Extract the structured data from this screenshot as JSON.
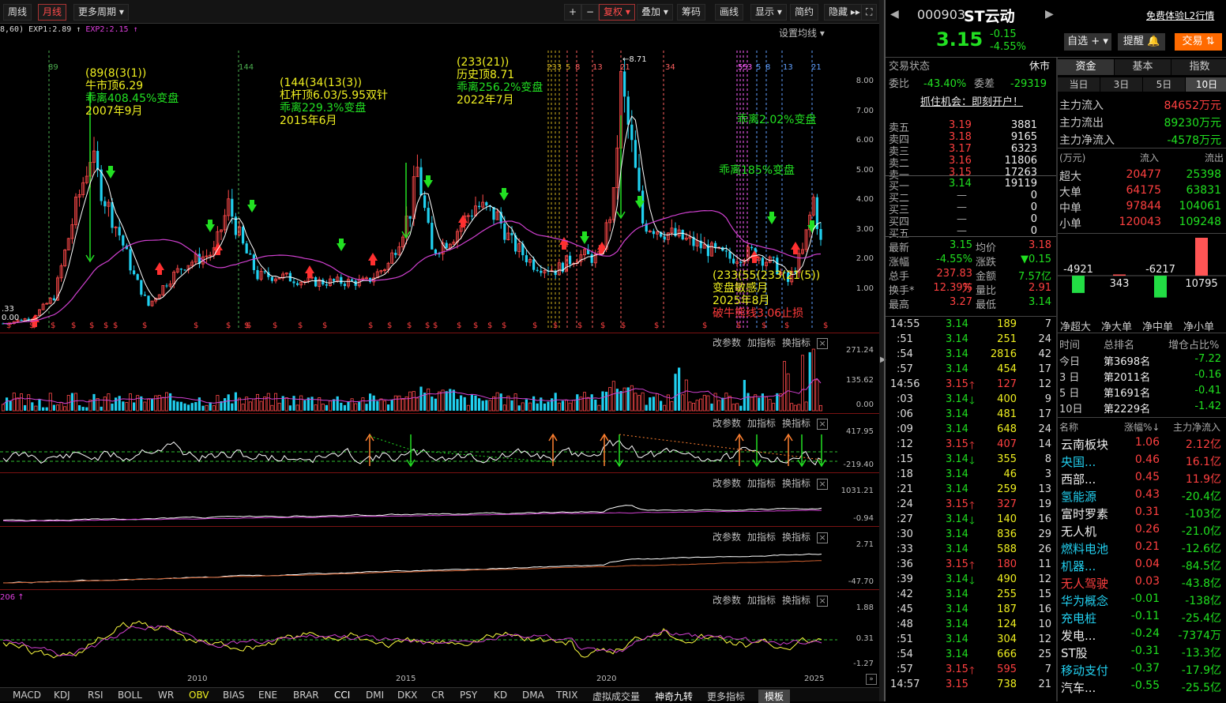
{
  "toolbar": {
    "period_week": "周线",
    "period_month": "月线",
    "more_period": "更多周期 ▾",
    "plus": "+",
    "minus": "−",
    "fq": "复权 ▾",
    "overlay": "叠加 ▾",
    "chips": "筹码",
    "draw": "画线",
    "display": "显示 ▾",
    "simple": "简约",
    "hide": "隐藏 ▸▸",
    "full": "⛶"
  },
  "params": {
    "text": "8,60)  EXP1:2.89 ↑  ",
    "exp2": "EXP2:2.15 ↑",
    "setting": "设置均线 ▾"
  },
  "main_chart": {
    "y_ticks": [
      "8.00",
      "7.00",
      "6.00",
      "5.00",
      "4.00",
      "3.00",
      "2.00",
      "1.00"
    ],
    "x_ticks": [
      "2010",
      "2015",
      "2020",
      "2025"
    ],
    "ann1": [
      "(89(8(3(1))",
      "牛市顶6.29",
      "乖离408.45%变盘",
      "2007年9月"
    ],
    "ann2": [
      "(144(34(13(3))",
      "杠杆顶6.03/5.95双针",
      "乖离229.3%变盘",
      "2015年6月"
    ],
    "ann3": [
      "(233(21))",
      "历史顶8.71",
      "乖离256.2%变盘",
      "2022年7月"
    ],
    "ann4": [
      "乖离2.02%变盘"
    ],
    "ann5": [
      "乖离185%变盘"
    ],
    "ann6": [
      "(233(55(233(21(5))",
      "变盘敏感月",
      "2025年8月",
      "破牛熊线3.06止损"
    ],
    "peak_label": "←8.71",
    "fib_labels": [
      "89",
      "144",
      "233",
      "5",
      "8",
      "13",
      "21",
      "34",
      "55",
      "3",
      "5",
      "8",
      "13",
      "21"
    ],
    "low_labels": [
      ".33",
      "0.00"
    ]
  },
  "sub_panels": [
    {
      "links": [
        "改参数",
        "加指标",
        "换指标"
      ],
      "ticks": [
        "271.24",
        "135.62",
        "0.00"
      ]
    },
    {
      "links": [
        "改参数",
        "加指标",
        "换指标"
      ],
      "ticks": [
        "417.95",
        "-219.40"
      ]
    },
    {
      "links": [
        "改参数",
        "加指标",
        "换指标"
      ],
      "ticks": [
        "1031.21",
        "-0.94"
      ]
    },
    {
      "links": [
        "改参数",
        "加指标",
        "换指标"
      ],
      "ticks": [
        "2.71",
        "-47.70"
      ]
    },
    {
      "links": [
        "改参数",
        "加指标",
        "换指标"
      ],
      "ticks": [
        "1.88",
        "0.31",
        "-1.27"
      ],
      "left_label": "206 ↑"
    }
  ],
  "bottom_tabs": [
    "MACD",
    "KDJ",
    "RSI",
    "BOLL",
    "WR",
    "OBV",
    "BIAS",
    "ENE",
    "BRAR",
    "CCI",
    "DMI",
    "DKX",
    "CR",
    "PSY",
    "KD",
    "DMA",
    "TRIX",
    "虚拟成交量",
    "神奇九转",
    "更多指标",
    "模板"
  ],
  "stock": {
    "code": "000903",
    "name": "ST云动",
    "price": "3.15",
    "change": "-0.15",
    "pct": "-4.55%",
    "promo": "免费体验L2行情",
    "btn_watch": "自选 + ▾",
    "btn_alert": "提醒 🔔",
    "btn_trade": "交易 ⇅"
  },
  "status": {
    "label": "交易状态",
    "value": "休市",
    "wb_label": "委比",
    "wb": "-43.40%",
    "wc_label": "委差",
    "wc": "-29319",
    "banner": "抓住机会：即刻开户！"
  },
  "asks": [
    {
      "l": "卖五",
      "p": "3.19",
      "v": "3881"
    },
    {
      "l": "卖四",
      "p": "3.18",
      "v": "9165"
    },
    {
      "l": "卖三",
      "p": "3.17",
      "v": "6323"
    },
    {
      "l": "卖二",
      "p": "3.16",
      "v": "11806"
    },
    {
      "l": "卖一",
      "p": "3.15",
      "v": "17263"
    }
  ],
  "bids": [
    {
      "l": "买一",
      "p": "3.14",
      "v": "19119"
    },
    {
      "l": "买二",
      "p": "—",
      "v": "0"
    },
    {
      "l": "买三",
      "p": "—",
      "v": "0"
    },
    {
      "l": "买四",
      "p": "—",
      "v": "0"
    },
    {
      "l": "买五",
      "p": "—",
      "v": "0"
    }
  ],
  "quote": [
    [
      "最新",
      "3.15",
      "均价",
      "3.18"
    ],
    [
      "涨幅",
      "-4.55%",
      "涨跌",
      "▼0.15"
    ],
    [
      "总手",
      "237.83万",
      "金额",
      "7.57亿"
    ],
    [
      "换手*",
      "12.39%",
      "量比",
      "2.91"
    ],
    [
      "最高",
      "3.27",
      "最低",
      "3.14"
    ]
  ],
  "ticks": [
    [
      "14:55",
      "3.14",
      "189",
      "7",
      ""
    ],
    [
      ":51",
      "3.14",
      "251",
      "24",
      ""
    ],
    [
      ":54",
      "3.14",
      "2816",
      "42",
      ""
    ],
    [
      ":57",
      "3.14",
      "454",
      "17",
      ""
    ],
    [
      "14:56",
      "3.15",
      "127",
      "12",
      "up"
    ],
    [
      ":03",
      "3.14",
      "400",
      "9",
      "dn"
    ],
    [
      ":06",
      "3.14",
      "481",
      "17",
      ""
    ],
    [
      ":09",
      "3.14",
      "648",
      "24",
      ""
    ],
    [
      ":12",
      "3.15",
      "407",
      "14",
      "up"
    ],
    [
      ":15",
      "3.14",
      "355",
      "8",
      "dn"
    ],
    [
      ":18",
      "3.14",
      "46",
      "3",
      ""
    ],
    [
      ":21",
      "3.14",
      "259",
      "13",
      ""
    ],
    [
      ":24",
      "3.15",
      "327",
      "19",
      "up"
    ],
    [
      ":27",
      "3.14",
      "140",
      "16",
      "dn"
    ],
    [
      ":30",
      "3.14",
      "836",
      "29",
      ""
    ],
    [
      ":33",
      "3.14",
      "588",
      "26",
      ""
    ],
    [
      ":36",
      "3.15",
      "180",
      "11",
      "up"
    ],
    [
      ":39",
      "3.14",
      "490",
      "12",
      "dn"
    ],
    [
      ":42",
      "3.14",
      "255",
      "15",
      ""
    ],
    [
      ":45",
      "3.14",
      "187",
      "16",
      ""
    ],
    [
      ":48",
      "3.14",
      "124",
      "10",
      ""
    ],
    [
      ":51",
      "3.14",
      "304",
      "12",
      ""
    ],
    [
      ":54",
      "3.14",
      "666",
      "25",
      ""
    ],
    [
      ":57",
      "3.15",
      "595",
      "7",
      "up"
    ],
    [
      "14:57",
      "3.15",
      "738",
      "21",
      ""
    ]
  ],
  "fund": {
    "tabs": [
      "资金",
      "基本",
      "指数"
    ],
    "periods": [
      "当日",
      "3日",
      "5日",
      "10日"
    ],
    "flows": [
      [
        "主力流入",
        "84652万元"
      ],
      [
        "主力流出",
        "89230万元"
      ],
      [
        "主力净流入",
        "-4578万元"
      ]
    ],
    "table_head": [
      "(万元)",
      "流入",
      "流出"
    ],
    "table": [
      [
        "超大",
        "20477",
        "25398"
      ],
      [
        "大单",
        "64175",
        "63831"
      ],
      [
        "中单",
        "97844",
        "104061"
      ],
      [
        "小单",
        "120043",
        "109248"
      ]
    ],
    "bars": [
      {
        "label": "-4921",
        "value": -4921
      },
      {
        "label": "343",
        "value": 343
      },
      {
        "label": "-6217",
        "value": -6217
      },
      {
        "label": "10795",
        "value": 10795
      }
    ],
    "bar_names": [
      "净超大",
      "净大单",
      "净中单",
      "净小单"
    ],
    "rank_head": [
      "时间",
      "总排名",
      "增仓占比%"
    ],
    "rank": [
      [
        "今日",
        "第3698名",
        "-7.22"
      ],
      [
        "3 日",
        "第2011名",
        "-0.16"
      ],
      [
        "5 日",
        "第1691名",
        "-0.41"
      ],
      [
        "10日",
        "第2229名",
        "-1.42"
      ]
    ],
    "sector_head": [
      "名称",
      "涨幅%↓",
      "主力净流入"
    ],
    "sectors": [
      [
        "云南板块",
        "1.06",
        "2.12亿"
      ],
      [
        "央国...",
        "0.46",
        "16.1亿"
      ],
      [
        "西部...",
        "0.45",
        "11.9亿"
      ],
      [
        "氢能源",
        "0.43",
        "-20.4亿"
      ],
      [
        "富时罗素",
        "0.31",
        "-103亿"
      ],
      [
        "无人机",
        "0.26",
        "-21.0亿"
      ],
      [
        "燃料电池",
        "0.21",
        "-12.6亿"
      ],
      [
        "机器...",
        "0.04",
        "-84.5亿"
      ],
      [
        "无人驾驶",
        "0.03",
        "-43.8亿"
      ],
      [
        "华为概念",
        "-0.01",
        "-138亿"
      ],
      [
        "充电桩",
        "-0.11",
        "-25.4亿"
      ],
      [
        "发电...",
        "-0.24",
        "-7374万"
      ],
      [
        "ST股",
        "-0.31",
        "-13.3亿"
      ],
      [
        "移动支付",
        "-0.37",
        "-17.9亿"
      ],
      [
        "汽车...",
        "-0.55",
        "-25.5亿"
      ]
    ]
  }
}
